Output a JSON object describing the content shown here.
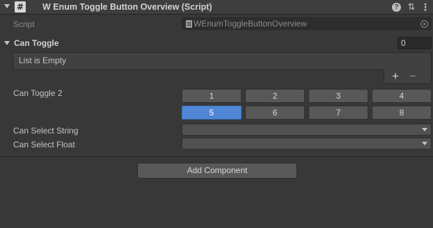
{
  "component": {
    "title": "W Enum Toggle Button Overview (Script)",
    "badge_glyph": "#",
    "header_icons": [
      "fold-arrow-icon",
      "script-icon",
      "help-icon",
      "presets-icon",
      "kebab-menu-icon"
    ],
    "help_glyph": "?",
    "presets_glyph": "⇅",
    "more_glyph": "⋮"
  },
  "script_field": {
    "label": "Script",
    "value": "WEnumToggleButtonOverview"
  },
  "can_toggle": {
    "label": "Can Toggle",
    "size": "0",
    "empty_text": "List is Empty",
    "add_glyph": "+",
    "remove_glyph": "−"
  },
  "can_toggle_2": {
    "label": "Can Toggle 2",
    "buttons": [
      {
        "label": "1",
        "selected": false
      },
      {
        "label": "2",
        "selected": false
      },
      {
        "label": "3",
        "selected": false
      },
      {
        "label": "4",
        "selected": false
      },
      {
        "label": "5",
        "selected": true
      },
      {
        "label": "6",
        "selected": false
      },
      {
        "label": "7",
        "selected": false
      },
      {
        "label": "8",
        "selected": false
      }
    ]
  },
  "can_select_string": {
    "label": "Can Select String",
    "value": ""
  },
  "can_select_float": {
    "label": "Can Select Float",
    "value": ""
  },
  "add_component": {
    "label": "Add Component"
  },
  "colors": {
    "background": "#383838",
    "header": "#3e3e3e",
    "selected_toggle": "#4f86d6",
    "toggle": "#585858"
  }
}
